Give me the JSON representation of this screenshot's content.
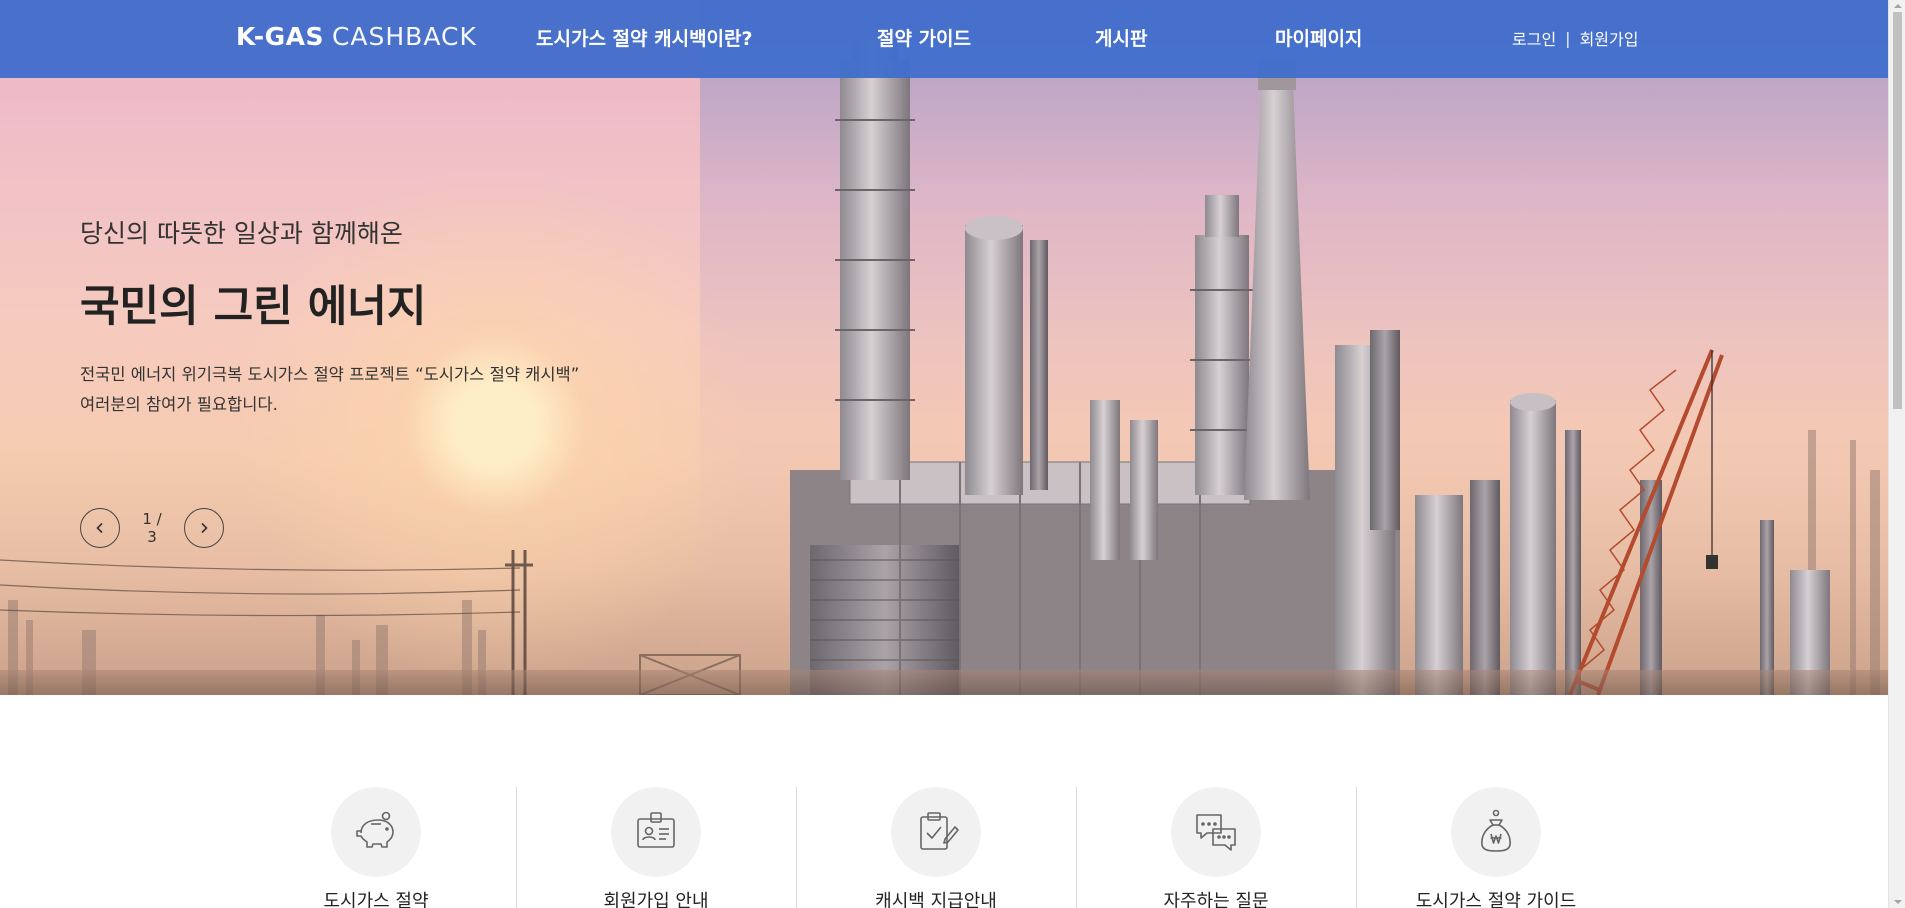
{
  "header": {
    "logo_bold": "K-GAS",
    "logo_light": "CASHBACK",
    "nav": [
      {
        "label": "도시가스 절약 캐시백이란?"
      },
      {
        "label": "절약 가이드"
      },
      {
        "label": "게시판"
      },
      {
        "label": "마이페이지"
      }
    ],
    "login": "로그인",
    "separator": "|",
    "signup": "회원가입"
  },
  "hero": {
    "subtitle": "당신의 따뜻한 일상과 함께해온",
    "title": "국민의 그린 에너지",
    "desc_line1": "전국민 에너지 위기극복 도시가스 절약 프로젝트 “도시가스 절약 캐시백”",
    "desc_line2": "여러분의 참여가 필요합니다.",
    "slide_counter": "1 / 3",
    "slide_current": 1,
    "slide_total": 3
  },
  "services": [
    {
      "label": "도시가스 절약",
      "icon": "piggy-bank-icon"
    },
    {
      "label": "회원가입 안내",
      "icon": "id-card-icon"
    },
    {
      "label": "캐시백 지급안내",
      "icon": "clipboard-check-icon"
    },
    {
      "label": "자주하는 질문",
      "icon": "chat-bubbles-icon"
    },
    {
      "label": "도시가스 절약 가이드",
      "icon": "money-bag-icon"
    }
  ],
  "colors": {
    "header_bg": "#426ecc",
    "text_dark": "#222222",
    "icon_circle": "#f1f1f1"
  }
}
